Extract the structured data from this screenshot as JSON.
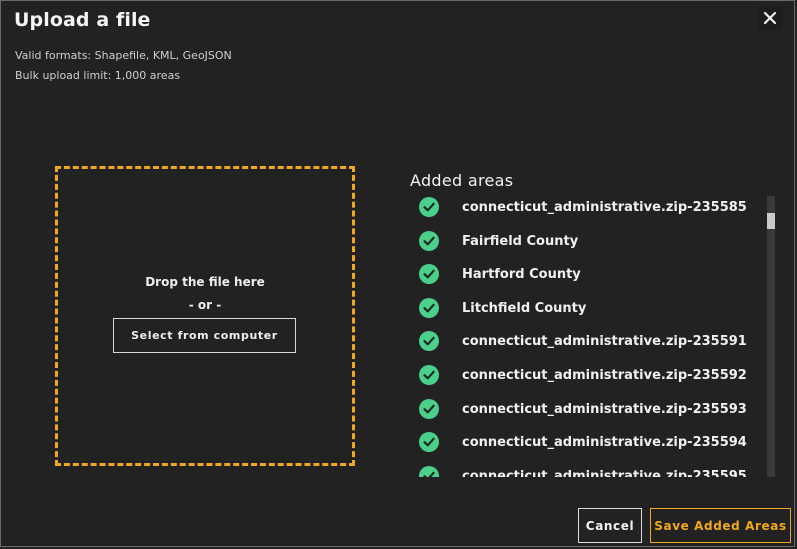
{
  "modal": {
    "title": "Upload a file",
    "valid_formats": "Valid formats: Shapefile, KML, GeoJSON",
    "bulk_limit": "Bulk upload limit: 1,000 areas",
    "close_icon": "close-icon"
  },
  "dropzone": {
    "drop_text": "Drop the file here",
    "or_text": "- or -",
    "select_button": "Select from computer",
    "border_color": "#f2a81d"
  },
  "added_areas": {
    "title": "Added areas",
    "status_icon": "check-circle-icon",
    "status_color": "#4ad08a",
    "items": [
      {
        "label": "connecticut_administrative.zip-235585"
      },
      {
        "label": "Fairfield County"
      },
      {
        "label": "Hartford County"
      },
      {
        "label": "Litchfield County"
      },
      {
        "label": "connecticut_administrative.zip-235591"
      },
      {
        "label": "connecticut_administrative.zip-235592"
      },
      {
        "label": "connecticut_administrative.zip-235593"
      },
      {
        "label": "connecticut_administrative.zip-235594"
      },
      {
        "label": "connecticut_administrative.zip-235595"
      }
    ]
  },
  "footer": {
    "cancel_label": "Cancel",
    "save_label": "Save Added Areas",
    "accent_color": "#f2a81d"
  }
}
